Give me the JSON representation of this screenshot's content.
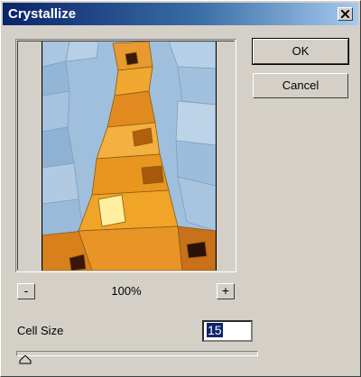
{
  "window": {
    "title": "Crystallize"
  },
  "preview": {
    "zoom_level": "100%",
    "zoom_out_label": "-",
    "zoom_in_label": "+"
  },
  "buttons": {
    "ok_label": "OK",
    "cancel_label": "Cancel"
  },
  "cell_size": {
    "label": "Cell Size",
    "value": "15",
    "slider_fraction": 0.04
  },
  "icons": {
    "close": "close-icon",
    "slider": "slider-thumb-icon"
  },
  "colors": {
    "titlebar_start": "#0a246a",
    "titlebar_end": "#a6caf0",
    "dialog_bg": "#d4d0c8"
  }
}
